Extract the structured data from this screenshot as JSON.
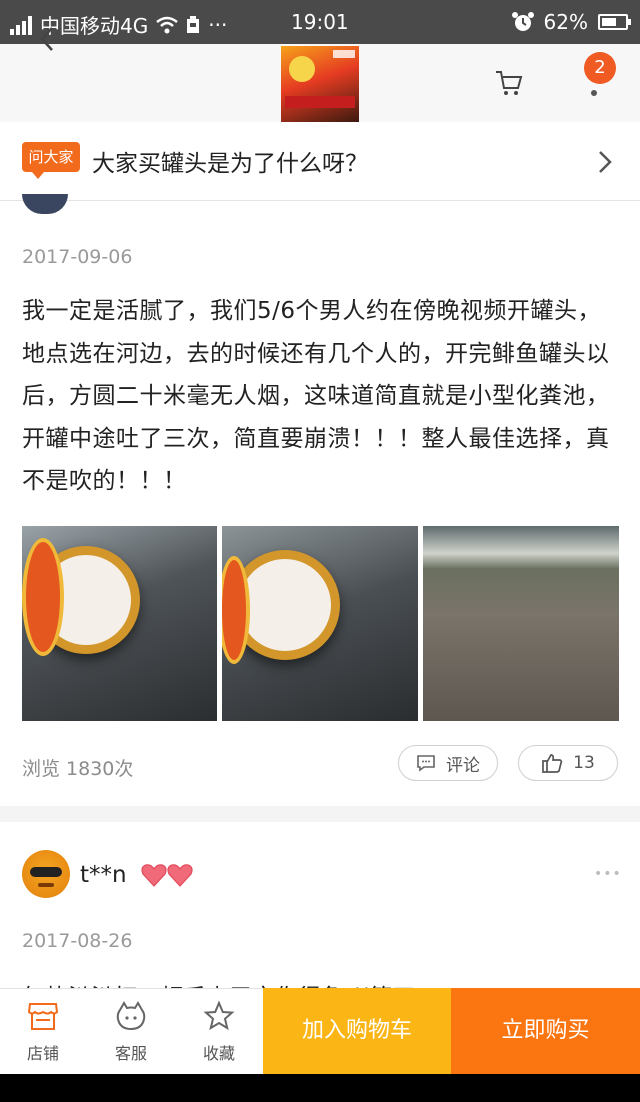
{
  "status_bar": {
    "carrier": "中国移动4G",
    "time": "19:01",
    "battery": "62%",
    "battery_level": 0.62
  },
  "nav": {
    "cart_badge": "2"
  },
  "question": {
    "tag": "问大家",
    "text": "大家买罐头是为了什么呀？"
  },
  "answers": [
    {
      "date": "2017-09-06",
      "text": "我一定是活腻了，我们5/6个男人约在傍晚视频开罐头，地点选在河边，去的时候还有几个人的，开完鲱鱼罐头以后，方圆二十米毫无人烟，这味道简直就是小型化粪池，开罐中途吐了三次，简直要崩溃！！！整人最佳选择，真不是吹的！！！",
      "views": "浏览 1830次",
      "comment_label": "评论",
      "likes": "13"
    },
    {
      "username": "t**n",
      "date": "2017-08-26",
      "text_partial": "气势汹汹打一顿后少甲文伤得急 ((第四"
    }
  ],
  "bottom_bar": {
    "store": "店铺",
    "service": "客服",
    "favorite": "收藏",
    "add_to_cart": "加入购物车",
    "buy_now": "立即购买"
  },
  "colors": {
    "accent_orange": "#f26b1d",
    "cart_button": "#fbb515",
    "buy_button": "#fb7511"
  }
}
